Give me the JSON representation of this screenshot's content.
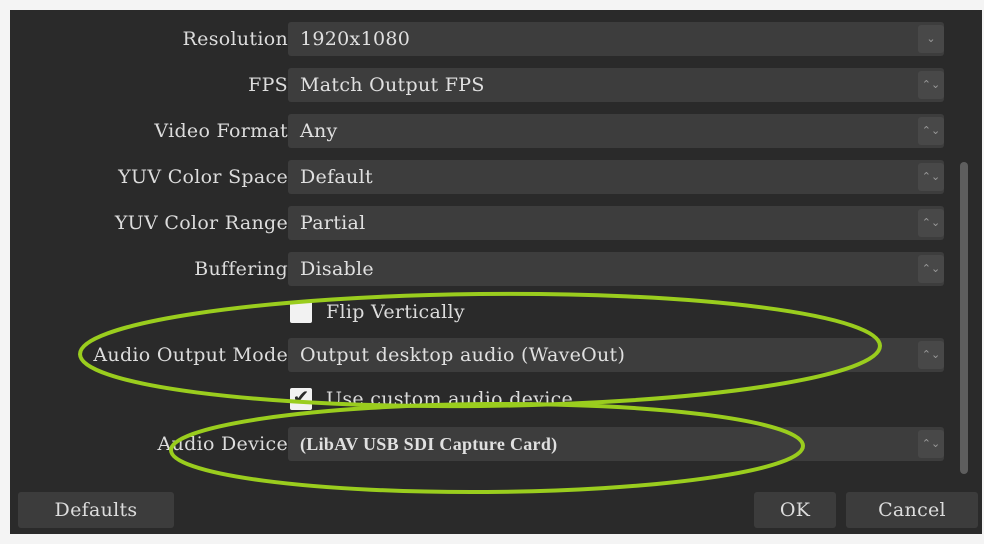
{
  "settings": {
    "rows": [
      {
        "label": "Resolution",
        "value": "1920x1080",
        "arrow": "chevron-down"
      },
      {
        "label": "FPS",
        "value": "Match Output FPS",
        "arrow": "up-down"
      },
      {
        "label": "Video Format",
        "value": "Any",
        "arrow": "up-down"
      },
      {
        "label": "YUV Color Space",
        "value": "Default",
        "arrow": "up-down"
      },
      {
        "label": "YUV Color Range",
        "value": "Partial",
        "arrow": "up-down"
      },
      {
        "label": "Buffering",
        "value": "Disable",
        "arrow": "up-down"
      }
    ],
    "flip_vertically": {
      "label": "Flip Vertically",
      "checked": false
    },
    "audio_output_mode": {
      "label": "Audio Output Mode",
      "value": "Output desktop audio (WaveOut)",
      "arrow": "up-down"
    },
    "use_custom_audio_device": {
      "label": "Use custom audio device",
      "checked": true
    },
    "audio_device": {
      "label": "Audio Device",
      "value": "(LibAV USB SDI Capture Card)",
      "arrow": "up-down"
    }
  },
  "buttons": {
    "defaults": "Defaults",
    "ok": "OK",
    "cancel": "Cancel"
  },
  "icons": {
    "chevron_down": "⌄",
    "up_down": "⌃⌄",
    "check": "✔"
  },
  "colors": {
    "background": "#2a2a2a",
    "field": "#3d3d3d",
    "text": "#dcdcdc",
    "annotation": "#9acd1e"
  }
}
